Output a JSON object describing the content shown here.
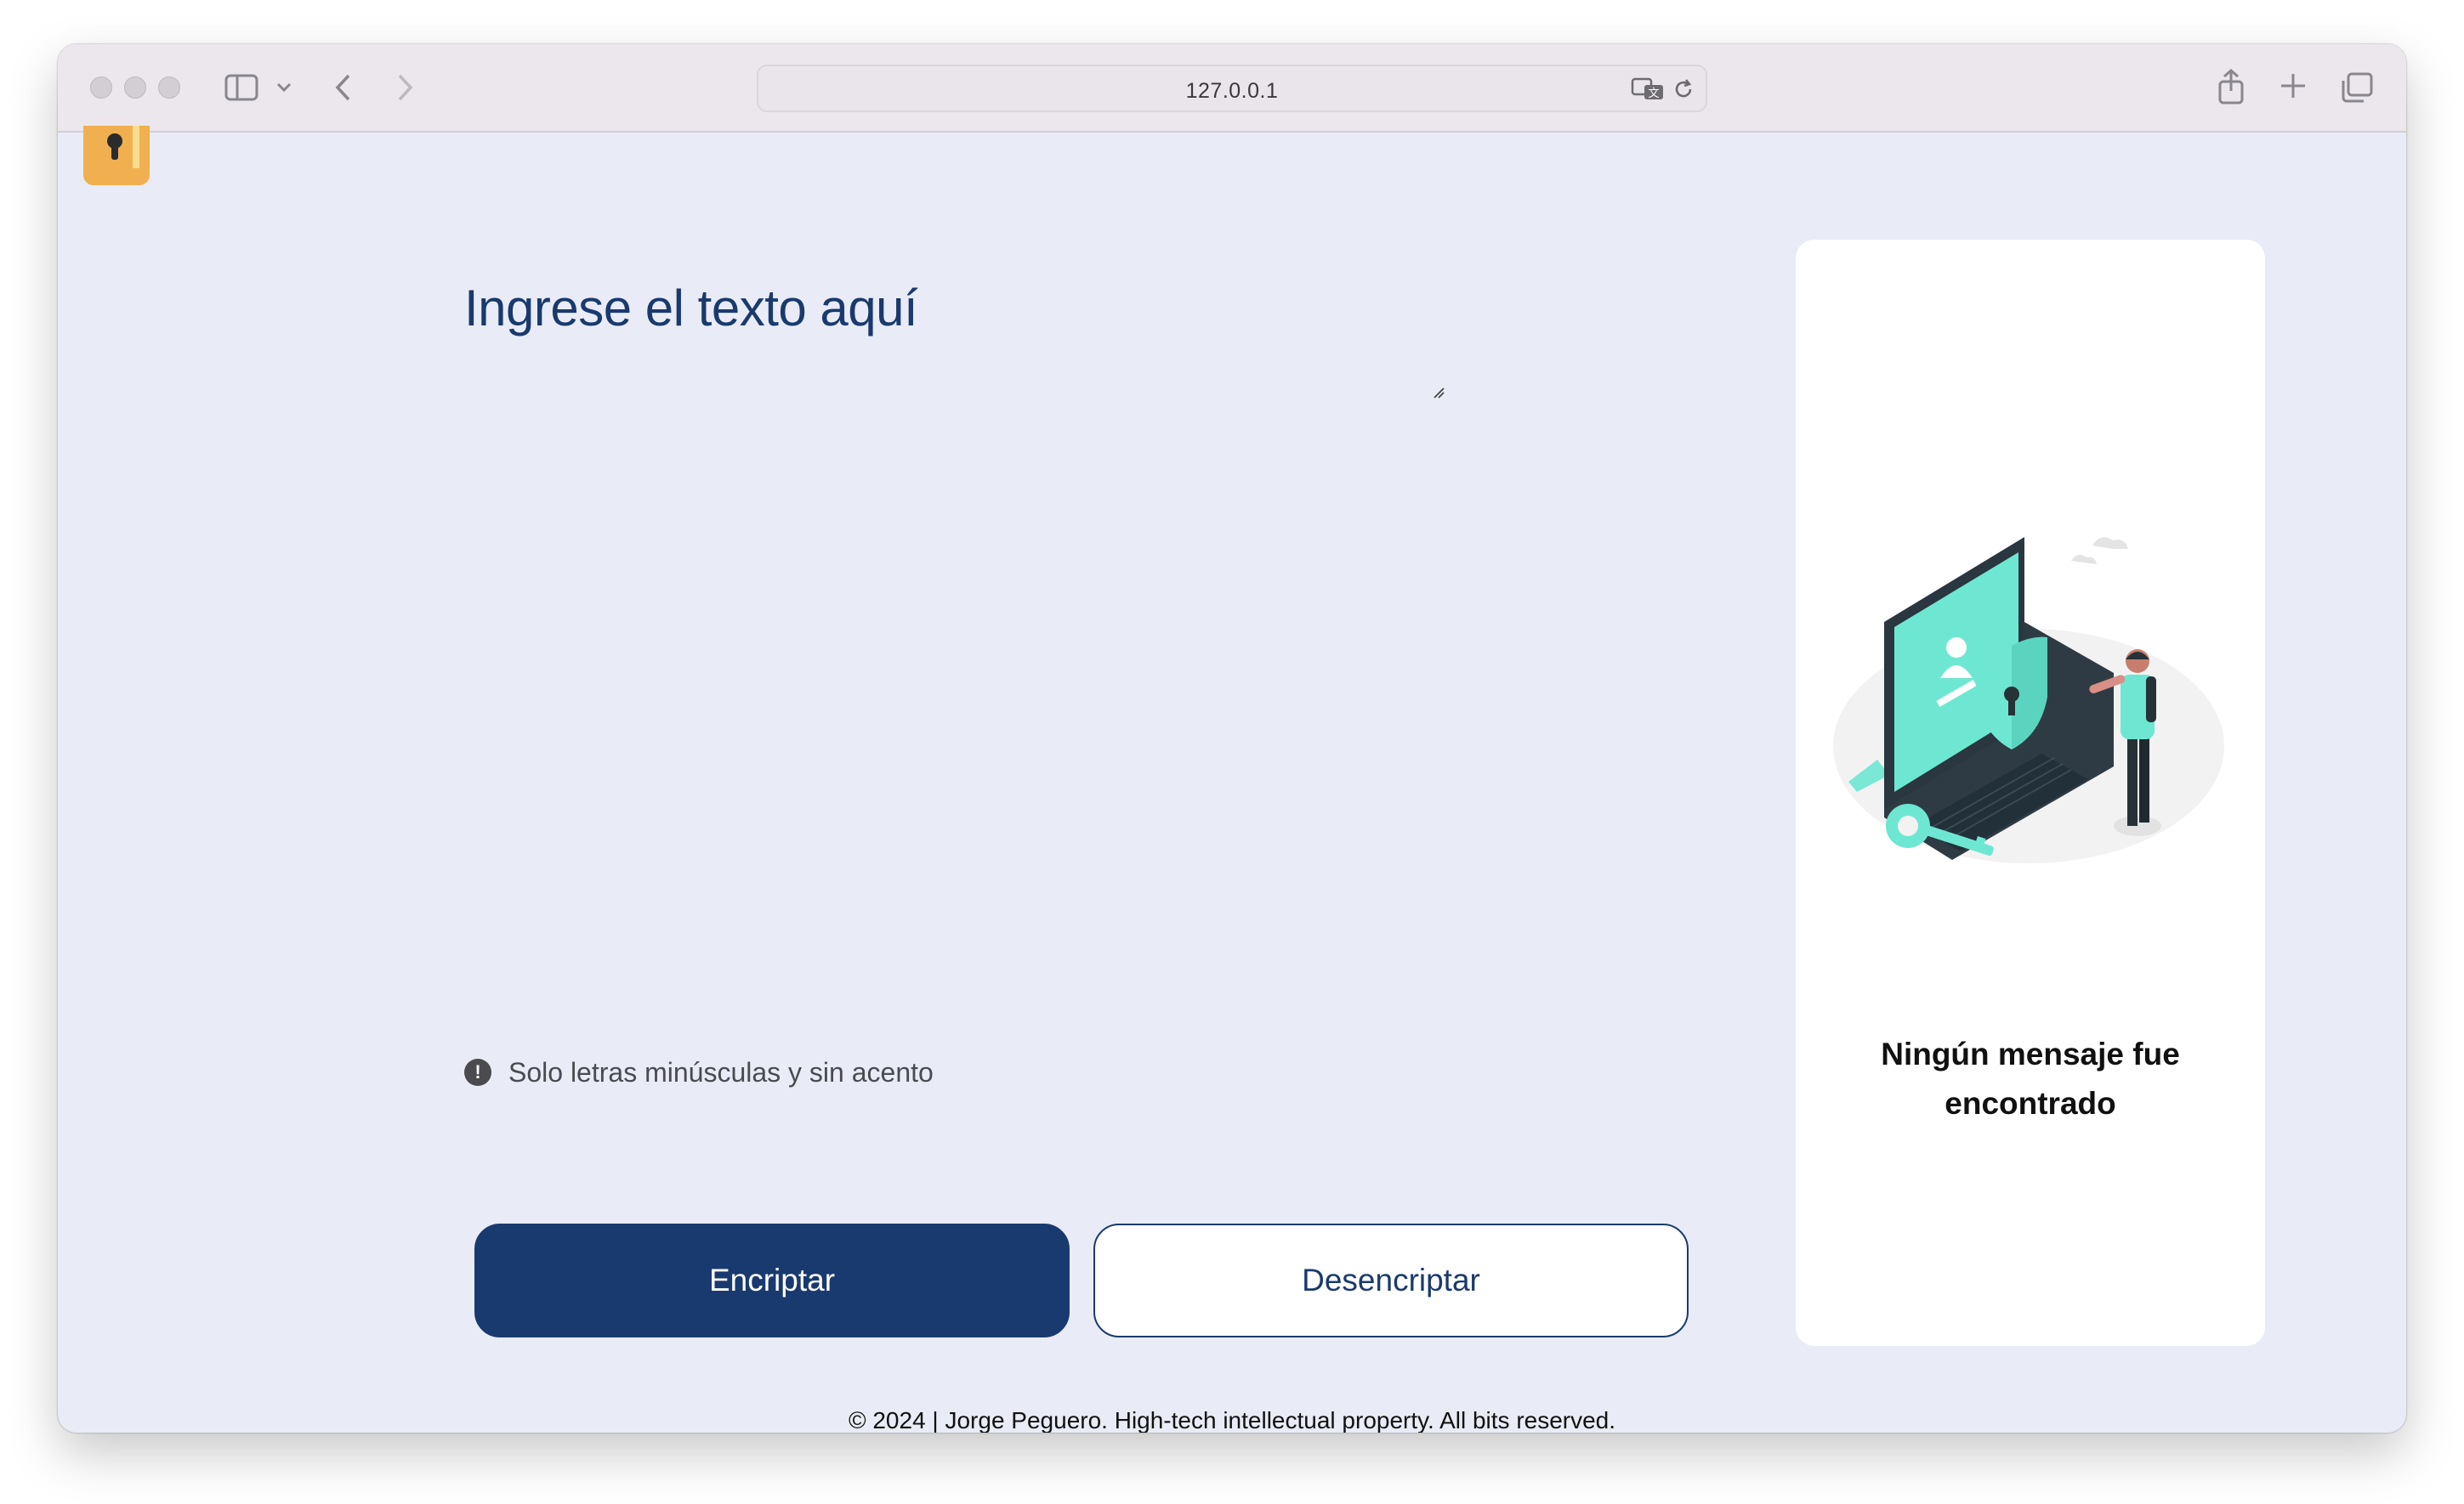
{
  "browser": {
    "url": "127.0.0.1"
  },
  "main": {
    "placeholder": "Ingrese el texto aquí",
    "hint": "Solo letras minúsculas y sin acento",
    "encrypt_label": "Encriptar",
    "decrypt_label": "Desencriptar"
  },
  "result": {
    "message": "Ningún mensaje fue encontrado"
  },
  "footer": {
    "text": "© 2024 | Jorge Peguero. High-tech intellectual property. All bits reserved."
  },
  "colors": {
    "primary": "#193a6f",
    "background": "#e9ecf6",
    "logo": "#f0b04f",
    "illustration_accent": "#6ee7d2"
  }
}
